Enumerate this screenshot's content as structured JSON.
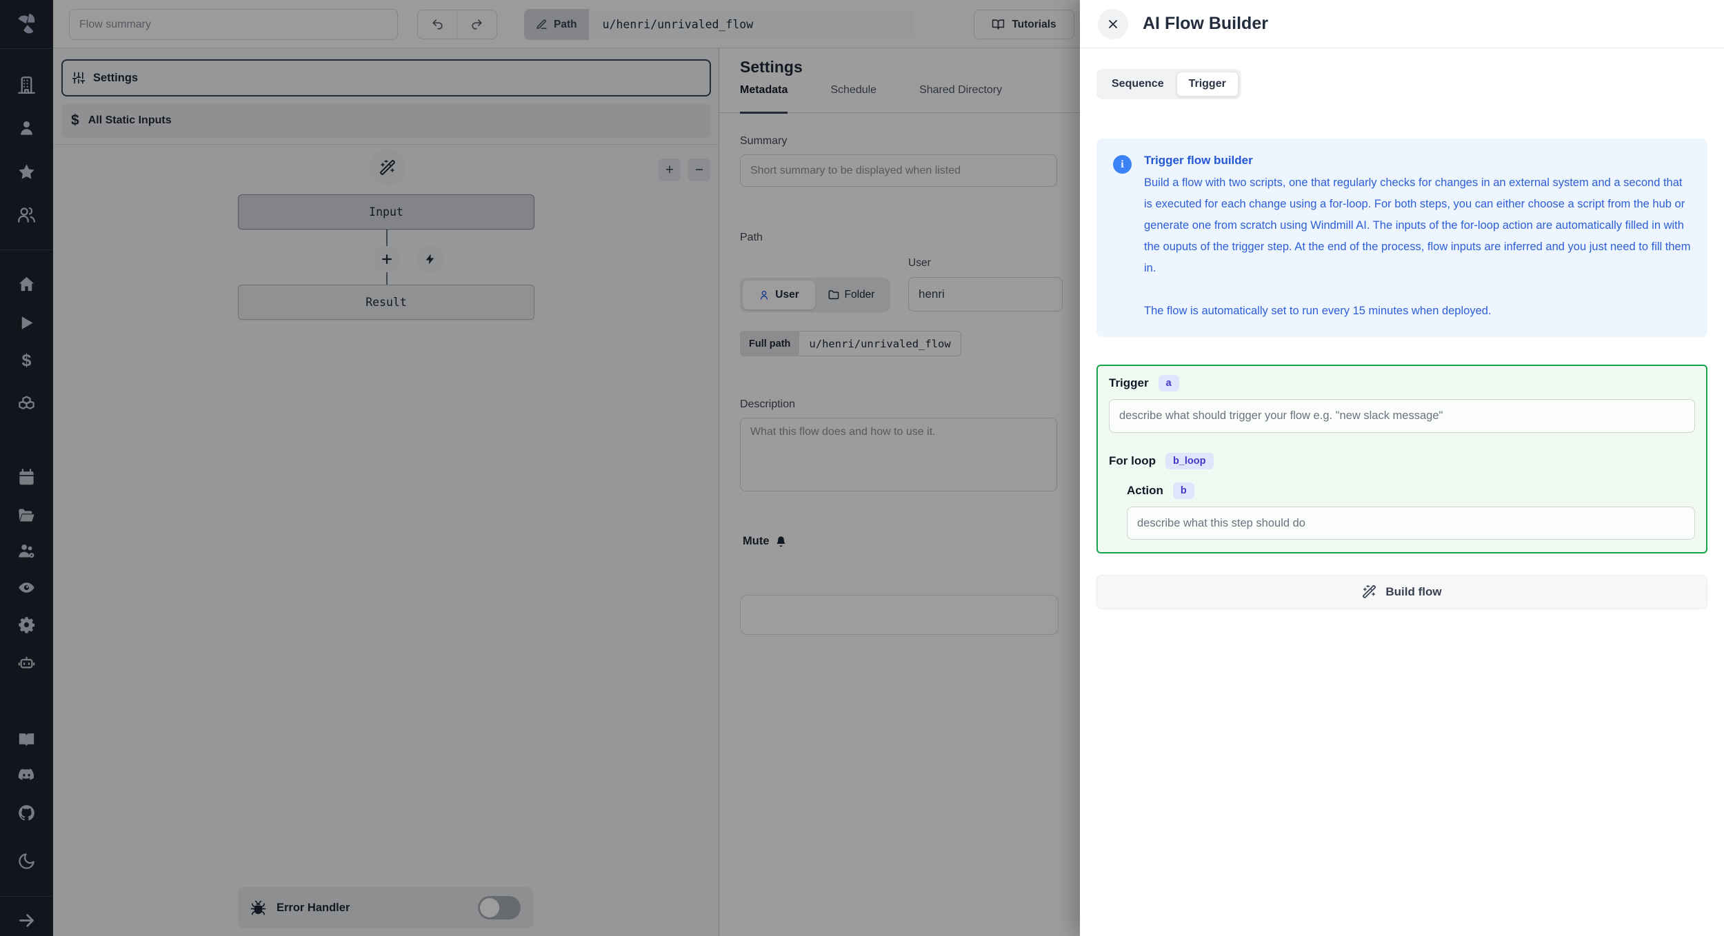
{
  "topbar": {
    "flow_summary_placeholder": "Flow summary",
    "path_label": "Path",
    "path_value": "u/henri/unrivaled_flow",
    "tutorials_label": "Tutorials"
  },
  "sidebar": {
    "icons": [
      "windmill-logo",
      "building",
      "user",
      "star",
      "users",
      "home",
      "play",
      "dollar",
      "boxes",
      "calendar",
      "folder-open",
      "user-cog",
      "eye",
      "settings-gear",
      "bot",
      "book-open",
      "discord",
      "github",
      "moon",
      "arrow-right"
    ]
  },
  "icons": {
    "dollar": "$",
    "zoom_in": "+",
    "zoom_out": "−"
  },
  "flow_panel": {
    "settings_label": "Settings",
    "static_inputs_label": "All Static Inputs",
    "input_node_label": "Input",
    "result_node_label": "Result",
    "error_handler_label": "Error Handler"
  },
  "settings_panel": {
    "title": "Settings",
    "tabs": [
      "Metadata",
      "Schedule",
      "Shared Directory"
    ],
    "active_tab": "Metadata",
    "summary_label": "Summary",
    "summary_placeholder": "Short summary to be displayed when listed",
    "path_label": "Path",
    "user_label": "User",
    "user_toggle": "User",
    "folder_toggle": "Folder",
    "owner_value": "henri",
    "full_path_label": "Full path",
    "full_path_value": "u/henri/unrivaled_flow",
    "description_label": "Description",
    "description_placeholder": "What this flow does and how to use it.",
    "mute_label": "Mute"
  },
  "ai_panel": {
    "title": "AI Flow Builder",
    "tabs": [
      "Sequence",
      "Trigger"
    ],
    "active_tab": "Trigger",
    "info": {
      "title": "Trigger flow builder",
      "body": "Build a flow with two scripts, one that regularly checks for changes in an external system and a second that is executed for each change using a for-loop. For both steps, you can either choose a script from the hub or generate one from scratch using Windmill AI. The inputs of the for-loop action are automatically filled in with the ouputs of the trigger step. At the end of the process, flow inputs are inferred and you just need to fill them in.",
      "note": "The flow is automatically set to run every 15 minutes when deployed."
    },
    "builder": {
      "trigger_label": "Trigger",
      "trigger_badge": "a",
      "trigger_placeholder": "describe what should trigger your flow e.g. \"new slack message\"",
      "forloop_label": "For loop",
      "forloop_badge": "b_loop",
      "action_label": "Action",
      "action_badge": "b",
      "action_placeholder": "describe what this step should do"
    },
    "build_button_label": "Build flow"
  },
  "colors": {
    "accent_green": "#16a34a",
    "info_blue": "#2e5ed6",
    "badge_indigo_bg": "#dfe5fb",
    "badge_indigo_text": "#4338ca",
    "sidebar_bg": "#1d222c"
  }
}
